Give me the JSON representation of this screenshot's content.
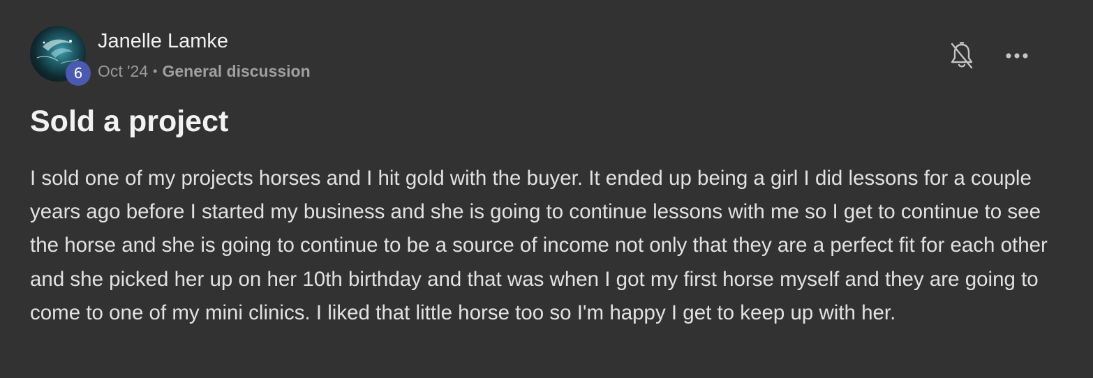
{
  "post": {
    "author": {
      "name": "Janelle Lamke",
      "avatar_alt": "Lasting Impressions",
      "level": "6"
    },
    "meta": {
      "date": "Oct '24",
      "separator": "•",
      "category": "General discussion"
    },
    "actions": {
      "notify_icon": "bell-off-icon",
      "more_icon": "more-horizontal-icon"
    },
    "title": "Sold a project",
    "body": "I sold one of my projects horses and I hit gold with the buyer. It ended up being a girl I did lessons for a couple years ago before I started my business and she is going to continue lessons with me so I get to continue to see the horse and she is going to continue to be a source of income not only that they are a perfect fit for each other and she picked her up on her 10th birthday and that was when I got my first horse myself and they are going to come to one of my mini clinics. I liked that little horse too so I'm happy I get to keep up with her."
  },
  "colors": {
    "background": "#323232",
    "text": "#e2e2e2",
    "muted": "#9a9a9a",
    "badge": "#4a5ab0"
  }
}
